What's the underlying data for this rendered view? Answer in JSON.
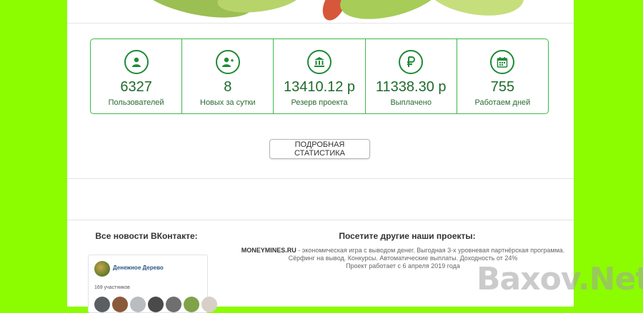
{
  "stats": [
    {
      "icon": "user-icon",
      "value": "6327",
      "label": "Пользователей"
    },
    {
      "icon": "user-plus-icon",
      "value": "8",
      "label": "Новых за сутки"
    },
    {
      "icon": "bank-icon",
      "value": "13410.12 р",
      "label": "Резерв проекта"
    },
    {
      "icon": "ruble-icon",
      "value": "11338.30 р",
      "label": "Выплачено"
    },
    {
      "icon": "calendar-icon",
      "value": "755",
      "label": "Работаем дней"
    }
  ],
  "stats_button": "ПОДРОБНАЯ СТАТИСТИКА",
  "vk": {
    "heading": "Все новости ВКонтакте:",
    "group_name": "Денежное Дерево",
    "members": "169 участников"
  },
  "projects": {
    "heading": "Посетите другие наши проекты:",
    "site": "MONEYMINES.RU",
    "line1": " - экономическая игра с выводом денег. Выгодная 3-х уровневая партнёрская программа.",
    "line2": "Сёрфинг на вывод. Конкурсы. Автоматические выплаты. Доходность от 24%",
    "line3": "Проект работает с 6 апреля 2019 года"
  },
  "watermark": "Baxov.Net",
  "colors": {
    "side_background": "#8cfc00",
    "accent_green": "#1e8a35",
    "border_green": "#3cb84a"
  }
}
